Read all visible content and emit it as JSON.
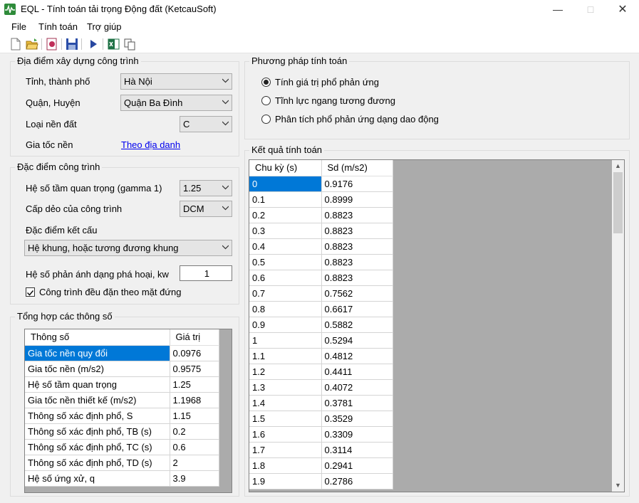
{
  "window": {
    "title": "EQL - Tính toán tải trọng Động đất (KetcauSoft)"
  },
  "menu": [
    "File",
    "Tính toán",
    "Trợ giúp"
  ],
  "location": {
    "title": "Địa điểm xây dựng công trình",
    "province_label": "Tỉnh, thành phố",
    "province_value": "Hà Nội",
    "district_label": "Quận, Huyện",
    "district_value": "Quận Ba Đình",
    "soil_label": "Loại nền đất",
    "soil_value": "C",
    "accel_label": "Gia tốc nền",
    "accel_link": "Theo địa danh"
  },
  "building": {
    "title": "Đặc điểm công trình",
    "importance_label": "Hệ số tầm quan trọng (gamma 1)",
    "importance_value": "1.25",
    "ductility_label": "Cấp dẻo của công trình",
    "ductility_value": "DCM",
    "structure_label": "Đặc điểm kết cấu",
    "structure_value": "Hệ khung, hoặc tương đương khung",
    "kw_label": "Hệ số phản ánh dạng phá hoại, kw",
    "kw_value": "1",
    "regular_label": "Công trình đều đặn theo mặt đứng",
    "regular_checked": true
  },
  "summary": {
    "title": "Tổng hợp các thông số",
    "headers": [
      "Thông số",
      "Giá trị"
    ],
    "rows": [
      [
        "Gia tốc nền quy đổi",
        "0.0976"
      ],
      [
        "Gia tốc nền (m/s2)",
        "0.9575"
      ],
      [
        "Hệ số tầm quan trọng",
        "1.25"
      ],
      [
        "Gia tốc nền thiết kế (m/s2)",
        "1.1968"
      ],
      [
        "Thông số xác định phổ, S",
        "1.15"
      ],
      [
        "Thông số xác định phổ, TB (s)",
        "0.2"
      ],
      [
        "Thông số xác định phổ, TC (s)",
        "0.6"
      ],
      [
        "Thông số xác định phổ, TD (s)",
        "2"
      ],
      [
        "Hệ số ứng xử, q",
        "3.9"
      ]
    ]
  },
  "method": {
    "title": "Phương pháp tính toán",
    "options": [
      "Tính giá trị phổ phản ứng",
      "Tĩnh lực ngang tương đương",
      "Phân tích phổ phản ứng dạng dao động"
    ],
    "selected_index": 0
  },
  "results": {
    "title": "Kết quả tính toán",
    "headers": [
      "Chu kỳ (s)",
      "Sd (m/s2)"
    ],
    "rows": [
      [
        "0",
        "0.9176"
      ],
      [
        "0.1",
        "0.8999"
      ],
      [
        "0.2",
        "0.8823"
      ],
      [
        "0.3",
        "0.8823"
      ],
      [
        "0.4",
        "0.8823"
      ],
      [
        "0.5",
        "0.8823"
      ],
      [
        "0.6",
        "0.8823"
      ],
      [
        "0.7",
        "0.7562"
      ],
      [
        "0.8",
        "0.6617"
      ],
      [
        "0.9",
        "0.5882"
      ],
      [
        "1",
        "0.5294"
      ],
      [
        "1.1",
        "0.4812"
      ],
      [
        "1.2",
        "0.4411"
      ],
      [
        "1.3",
        "0.4072"
      ],
      [
        "1.4",
        "0.3781"
      ],
      [
        "1.5",
        "0.3529"
      ],
      [
        "1.6",
        "0.3309"
      ],
      [
        "1.7",
        "0.3114"
      ],
      [
        "1.8",
        "0.2941"
      ],
      [
        "1.9",
        "0.2786"
      ]
    ]
  },
  "colors": {
    "selection": "#0078d7",
    "link": "#0000ee",
    "grid_background": "#ababab"
  },
  "icons": [
    "new-file-icon",
    "open-folder-icon",
    "report-icon",
    "save-icon",
    "run-icon",
    "excel-icon",
    "copy-icon"
  ]
}
